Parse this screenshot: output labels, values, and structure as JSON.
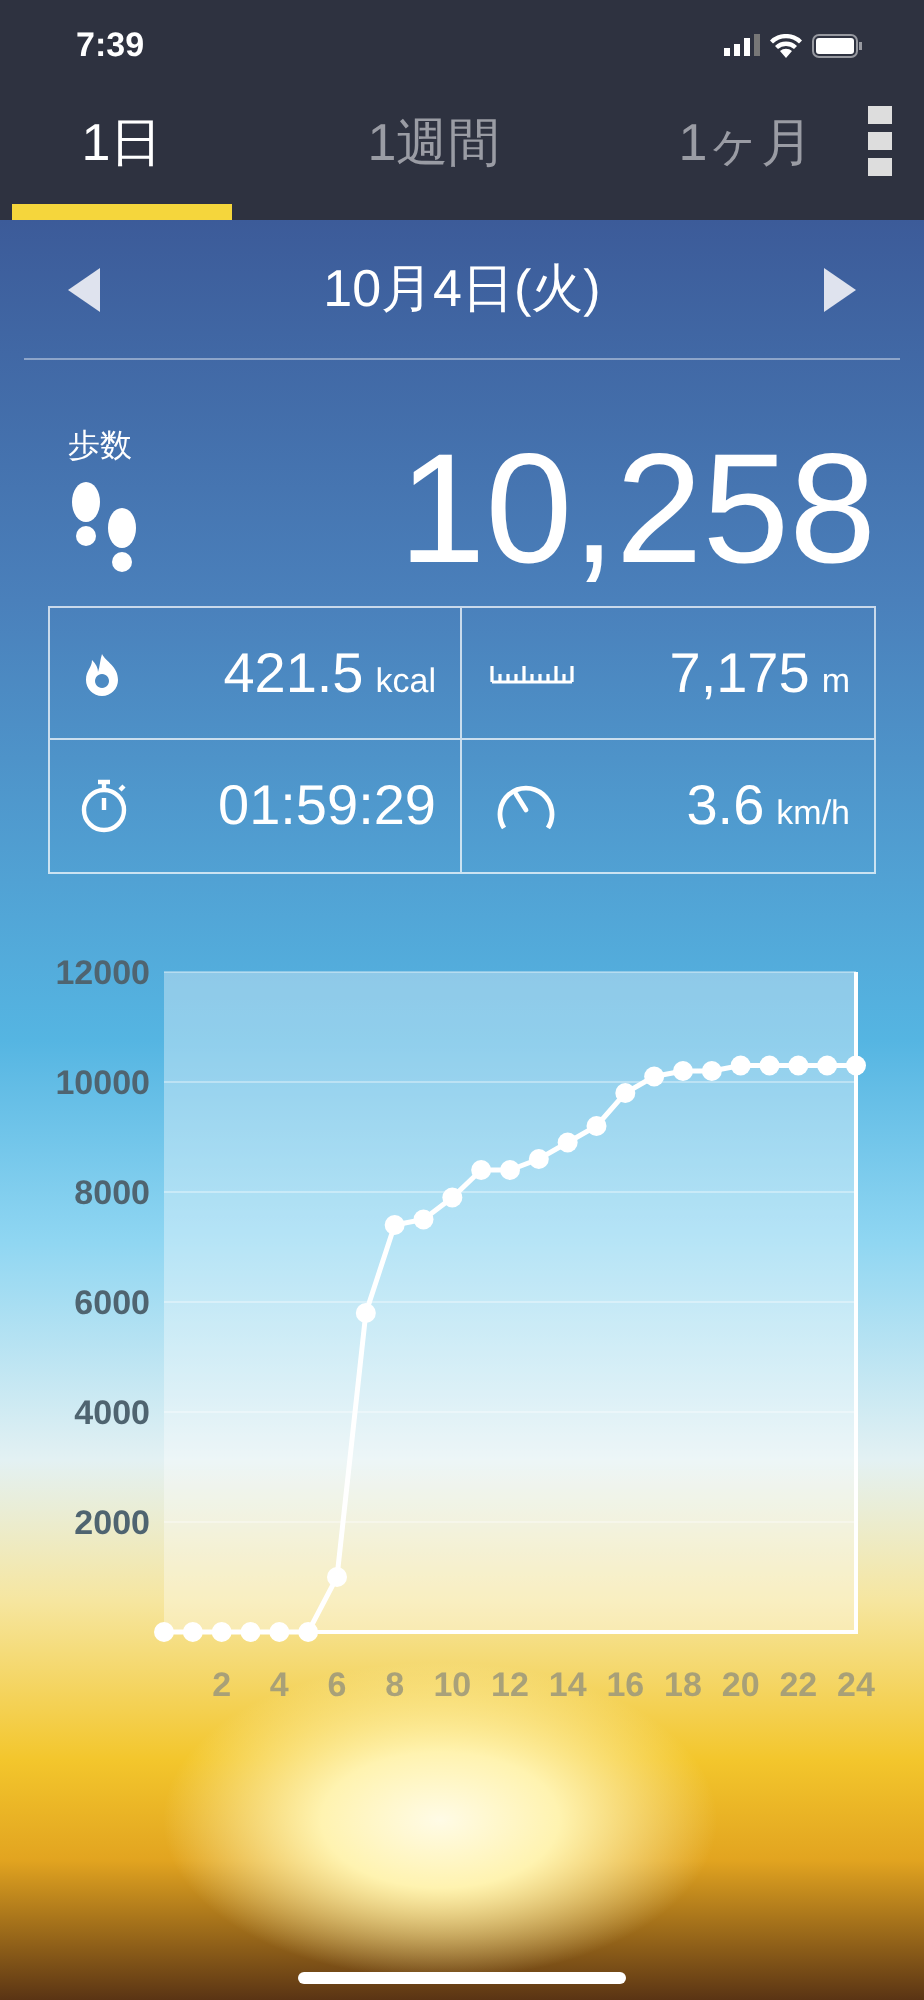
{
  "status_bar": {
    "time": "7:39"
  },
  "tabs": [
    {
      "label": "1日",
      "selected": true
    },
    {
      "label": "1週間",
      "selected": false
    },
    {
      "label": "1ヶ月",
      "selected": false
    }
  ],
  "date": "10月4日(火)",
  "steps": {
    "label": "歩数",
    "value": "10,258"
  },
  "stats": [
    {
      "kind": "calories",
      "value": "421.5",
      "unit": "kcal"
    },
    {
      "kind": "distance",
      "value": "7,175",
      "unit": "m"
    },
    {
      "kind": "time",
      "value": "01:59:29"
    },
    {
      "kind": "speed",
      "value": "3.6",
      "unit": "km/h"
    }
  ],
  "chart_data": {
    "type": "line",
    "x": [
      0,
      1,
      2,
      3,
      4,
      5,
      6,
      7,
      8,
      9,
      10,
      11,
      12,
      13,
      14,
      15,
      16,
      17,
      18,
      19,
      20,
      21,
      22,
      23,
      24
    ],
    "series": [
      {
        "color": "#ffffff",
        "marker": "circle",
        "values": [
          0,
          0,
          0,
          0,
          0,
          0,
          1000,
          5800,
          7400,
          7500,
          7900,
          8400,
          8400,
          8600,
          8900,
          9200,
          9800,
          10100,
          10200,
          10200,
          10300,
          10300,
          10300,
          10300,
          10300
        ]
      }
    ],
    "grid": true,
    "xlim": [
      0,
      24
    ],
    "ylim": [
      0,
      12000
    ],
    "xticks": [
      2,
      4,
      6,
      8,
      10,
      12,
      14,
      16,
      18,
      20,
      22,
      24
    ],
    "yticks": [
      2000,
      4000,
      6000,
      8000,
      10000,
      12000
    ]
  }
}
